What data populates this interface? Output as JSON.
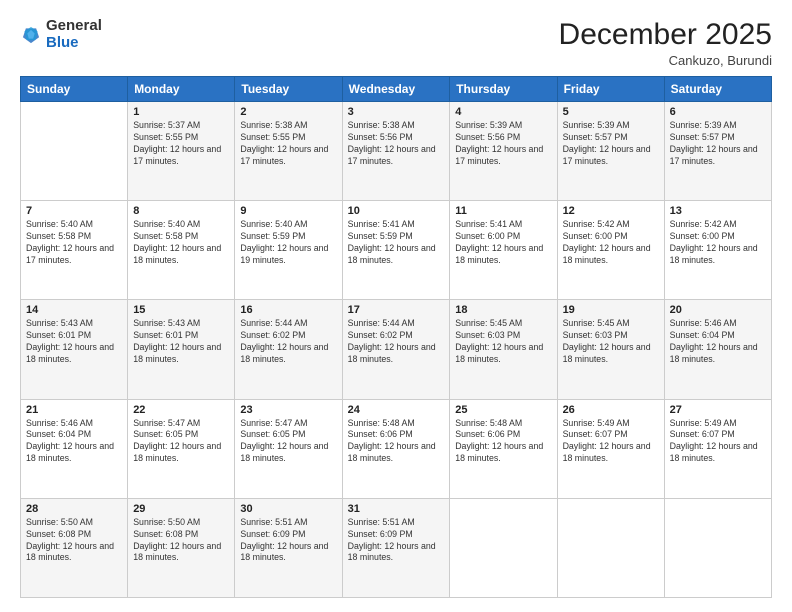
{
  "header": {
    "logo": {
      "general": "General",
      "blue": "Blue"
    },
    "title": "December 2025",
    "subtitle": "Cankuzo, Burundi"
  },
  "weekdays": [
    "Sunday",
    "Monday",
    "Tuesday",
    "Wednesday",
    "Thursday",
    "Friday",
    "Saturday"
  ],
  "weeks": [
    [
      {
        "day": "",
        "sunrise": "",
        "sunset": "",
        "daylight": ""
      },
      {
        "day": "1",
        "sunrise": "Sunrise: 5:37 AM",
        "sunset": "Sunset: 5:55 PM",
        "daylight": "Daylight: 12 hours and 17 minutes."
      },
      {
        "day": "2",
        "sunrise": "Sunrise: 5:38 AM",
        "sunset": "Sunset: 5:55 PM",
        "daylight": "Daylight: 12 hours and 17 minutes."
      },
      {
        "day": "3",
        "sunrise": "Sunrise: 5:38 AM",
        "sunset": "Sunset: 5:56 PM",
        "daylight": "Daylight: 12 hours and 17 minutes."
      },
      {
        "day": "4",
        "sunrise": "Sunrise: 5:39 AM",
        "sunset": "Sunset: 5:56 PM",
        "daylight": "Daylight: 12 hours and 17 minutes."
      },
      {
        "day": "5",
        "sunrise": "Sunrise: 5:39 AM",
        "sunset": "Sunset: 5:57 PM",
        "daylight": "Daylight: 12 hours and 17 minutes."
      },
      {
        "day": "6",
        "sunrise": "Sunrise: 5:39 AM",
        "sunset": "Sunset: 5:57 PM",
        "daylight": "Daylight: 12 hours and 17 minutes."
      }
    ],
    [
      {
        "day": "7",
        "sunrise": "Sunrise: 5:40 AM",
        "sunset": "Sunset: 5:58 PM",
        "daylight": "Daylight: 12 hours and 17 minutes."
      },
      {
        "day": "8",
        "sunrise": "Sunrise: 5:40 AM",
        "sunset": "Sunset: 5:58 PM",
        "daylight": "Daylight: 12 hours and 18 minutes."
      },
      {
        "day": "9",
        "sunrise": "Sunrise: 5:40 AM",
        "sunset": "Sunset: 5:59 PM",
        "daylight": "Daylight: 12 hours and 19 minutes."
      },
      {
        "day": "10",
        "sunrise": "Sunrise: 5:41 AM",
        "sunset": "Sunset: 5:59 PM",
        "daylight": "Daylight: 12 hours and 18 minutes."
      },
      {
        "day": "11",
        "sunrise": "Sunrise: 5:41 AM",
        "sunset": "Sunset: 6:00 PM",
        "daylight": "Daylight: 12 hours and 18 minutes."
      },
      {
        "day": "12",
        "sunrise": "Sunrise: 5:42 AM",
        "sunset": "Sunset: 6:00 PM",
        "daylight": "Daylight: 12 hours and 18 minutes."
      },
      {
        "day": "13",
        "sunrise": "Sunrise: 5:42 AM",
        "sunset": "Sunset: 6:00 PM",
        "daylight": "Daylight: 12 hours and 18 minutes."
      }
    ],
    [
      {
        "day": "14",
        "sunrise": "Sunrise: 5:43 AM",
        "sunset": "Sunset: 6:01 PM",
        "daylight": "Daylight: 12 hours and 18 minutes."
      },
      {
        "day": "15",
        "sunrise": "Sunrise: 5:43 AM",
        "sunset": "Sunset: 6:01 PM",
        "daylight": "Daylight: 12 hours and 18 minutes."
      },
      {
        "day": "16",
        "sunrise": "Sunrise: 5:44 AM",
        "sunset": "Sunset: 6:02 PM",
        "daylight": "Daylight: 12 hours and 18 minutes."
      },
      {
        "day": "17",
        "sunrise": "Sunrise: 5:44 AM",
        "sunset": "Sunset: 6:02 PM",
        "daylight": "Daylight: 12 hours and 18 minutes."
      },
      {
        "day": "18",
        "sunrise": "Sunrise: 5:45 AM",
        "sunset": "Sunset: 6:03 PM",
        "daylight": "Daylight: 12 hours and 18 minutes."
      },
      {
        "day": "19",
        "sunrise": "Sunrise: 5:45 AM",
        "sunset": "Sunset: 6:03 PM",
        "daylight": "Daylight: 12 hours and 18 minutes."
      },
      {
        "day": "20",
        "sunrise": "Sunrise: 5:46 AM",
        "sunset": "Sunset: 6:04 PM",
        "daylight": "Daylight: 12 hours and 18 minutes."
      }
    ],
    [
      {
        "day": "21",
        "sunrise": "Sunrise: 5:46 AM",
        "sunset": "Sunset: 6:04 PM",
        "daylight": "Daylight: 12 hours and 18 minutes."
      },
      {
        "day": "22",
        "sunrise": "Sunrise: 5:47 AM",
        "sunset": "Sunset: 6:05 PM",
        "daylight": "Daylight: 12 hours and 18 minutes."
      },
      {
        "day": "23",
        "sunrise": "Sunrise: 5:47 AM",
        "sunset": "Sunset: 6:05 PM",
        "daylight": "Daylight: 12 hours and 18 minutes."
      },
      {
        "day": "24",
        "sunrise": "Sunrise: 5:48 AM",
        "sunset": "Sunset: 6:06 PM",
        "daylight": "Daylight: 12 hours and 18 minutes."
      },
      {
        "day": "25",
        "sunrise": "Sunrise: 5:48 AM",
        "sunset": "Sunset: 6:06 PM",
        "daylight": "Daylight: 12 hours and 18 minutes."
      },
      {
        "day": "26",
        "sunrise": "Sunrise: 5:49 AM",
        "sunset": "Sunset: 6:07 PM",
        "daylight": "Daylight: 12 hours and 18 minutes."
      },
      {
        "day": "27",
        "sunrise": "Sunrise: 5:49 AM",
        "sunset": "Sunset: 6:07 PM",
        "daylight": "Daylight: 12 hours and 18 minutes."
      }
    ],
    [
      {
        "day": "28",
        "sunrise": "Sunrise: 5:50 AM",
        "sunset": "Sunset: 6:08 PM",
        "daylight": "Daylight: 12 hours and 18 minutes."
      },
      {
        "day": "29",
        "sunrise": "Sunrise: 5:50 AM",
        "sunset": "Sunset: 6:08 PM",
        "daylight": "Daylight: 12 hours and 18 minutes."
      },
      {
        "day": "30",
        "sunrise": "Sunrise: 5:51 AM",
        "sunset": "Sunset: 6:09 PM",
        "daylight": "Daylight: 12 hours and 18 minutes."
      },
      {
        "day": "31",
        "sunrise": "Sunrise: 5:51 AM",
        "sunset": "Sunset: 6:09 PM",
        "daylight": "Daylight: 12 hours and 18 minutes."
      },
      {
        "day": "",
        "sunrise": "",
        "sunset": "",
        "daylight": ""
      },
      {
        "day": "",
        "sunrise": "",
        "sunset": "",
        "daylight": ""
      },
      {
        "day": "",
        "sunrise": "",
        "sunset": "",
        "daylight": ""
      }
    ]
  ]
}
